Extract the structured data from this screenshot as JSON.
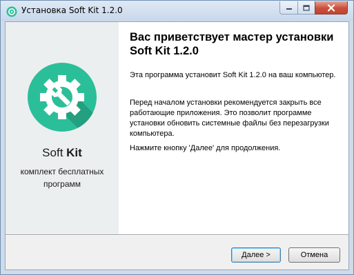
{
  "window": {
    "title": "Установка Soft Kit 1.2.0",
    "controls": {
      "minimize": "minimize",
      "maximize": "maximize",
      "close": "close"
    }
  },
  "sidebar": {
    "brand_regular": "Soft ",
    "brand_bold": "Kit",
    "tagline": "комплект бесплатных программ",
    "logo_icon": "gear-wrench-icon",
    "logo_color": "#2bbf99",
    "logo_shadow_color": "#249f80"
  },
  "welcome": {
    "heading": "Вас приветствует мастер установки Soft Kit 1.2.0",
    "paragraph1": "Эта программа установит Soft Kit 1.2.0 на ваш компьютер.",
    "paragraph2": "Перед началом установки рекомендуется закрыть все работающие приложения. Это позволит программе установки обновить системные файлы без перезагрузки компьютера.",
    "paragraph3": "Нажмите кнопку 'Далее' для продолжения."
  },
  "buttons": {
    "next_label": "Далее >",
    "cancel_label": "Отмена"
  }
}
